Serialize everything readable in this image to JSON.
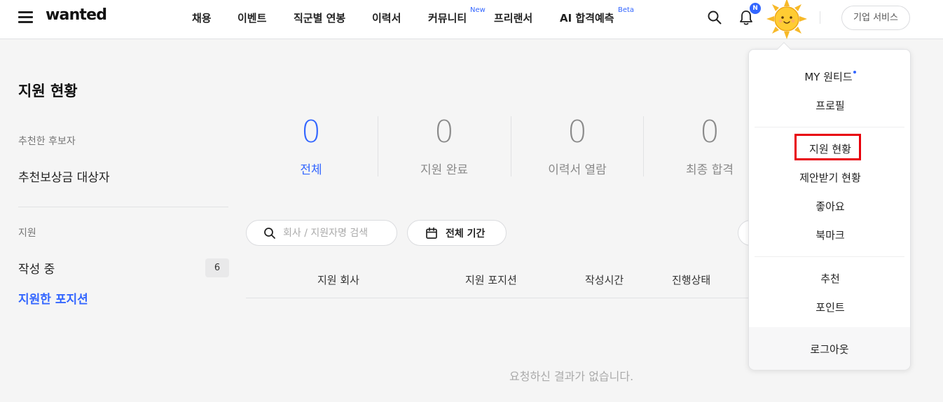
{
  "header": {
    "logo": "wanted",
    "nav": [
      {
        "label": "채용"
      },
      {
        "label": "이벤트"
      },
      {
        "label": "직군별 연봉"
      },
      {
        "label": "이력서"
      },
      {
        "label": "커뮤니티",
        "badge": "New"
      },
      {
        "label": "프리랜서"
      },
      {
        "label": "AI 합격예측",
        "badge": "Beta"
      }
    ],
    "notification_badge": "N",
    "business_button": "기업 서비스"
  },
  "sidebar": {
    "title": "지원 현황",
    "section1_label": "추천한 후보자",
    "referral_reward": "추천보상금 대상자",
    "section2_label": "지원",
    "drafting": "작성 중",
    "drafting_count": "6",
    "applied": "지원한 포지션"
  },
  "stats": [
    {
      "value": "0",
      "label": "전체",
      "active": true
    },
    {
      "value": "0",
      "label": "지원 완료"
    },
    {
      "value": "0",
      "label": "이력서 열람"
    },
    {
      "value": "0",
      "label": "최종 합격"
    }
  ],
  "filters": {
    "search_placeholder": "회사 / 지원자명 검색",
    "search_value": "",
    "period": "전체 기간"
  },
  "table": {
    "columns": [
      "지원 회사",
      "지원 포지션",
      "작성시간",
      "진행상태"
    ],
    "empty_message": "요청하신 결과가 없습니다."
  },
  "dropdown": {
    "items": [
      "MY 원티드",
      "프로필",
      "지원 현황",
      "제안받기 현황",
      "좋아요",
      "북마크",
      "추천",
      "포인트",
      "로그아웃"
    ],
    "highlighted": "지원 현황"
  },
  "colors": {
    "accent": "#3366ff",
    "highlight_box": "#e8000b"
  }
}
